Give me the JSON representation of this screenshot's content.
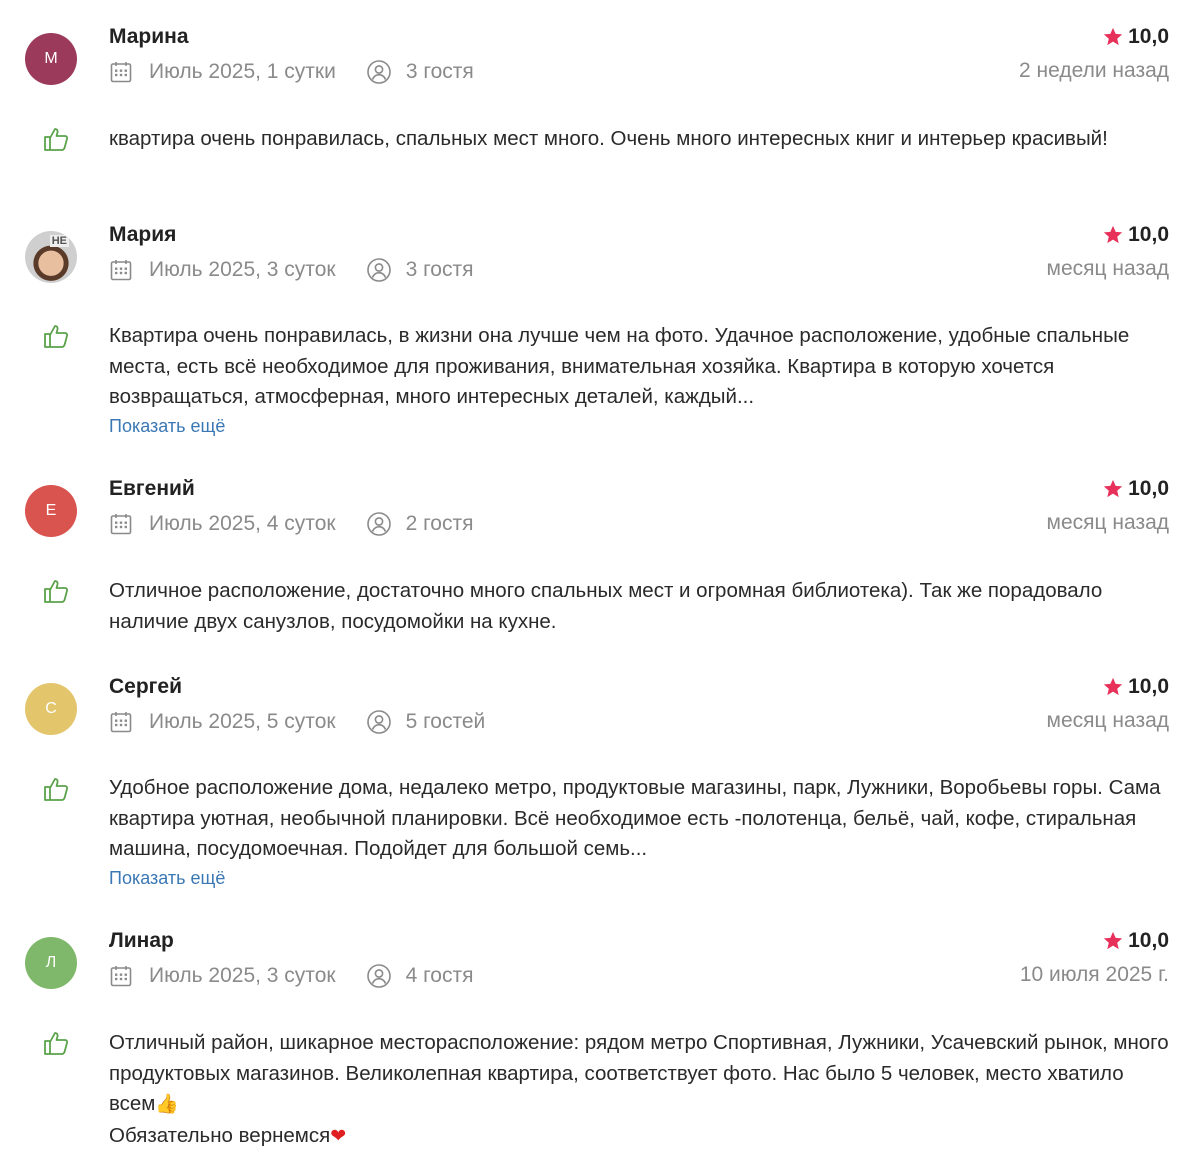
{
  "reviews": [
    {
      "initial": "М",
      "avatar_color": "#9c3a5c",
      "name": "Марина",
      "rating": "10,0",
      "stay": "Июль 2025, 1 сутки",
      "guests": "3 гостя",
      "when": "2 недели назад",
      "text": "квартира очень понравилась, спальных мест много. Очень много интересных книг и интерьер красивый!"
    },
    {
      "initial": "",
      "avatar_sign": "НЕ",
      "name": "Мария",
      "rating": "10,0",
      "stay": "Июль 2025, 3 суток",
      "guests": "3 гостя",
      "when": "месяц назад",
      "text": "Квартира очень понравилась, в жизни она лучше чем на фото. Удачное расположение, удобные спальные места, есть всё необходимое для проживания, внимательная хозяйка. Квартира в которую хочется возвращаться, атмосферная, много интересных деталей, каждый...",
      "more": "Показать ещё"
    },
    {
      "initial": "Е",
      "avatar_color": "#d9534f",
      "name": "Евгений",
      "rating": "10,0",
      "stay": "Июль 2025, 4 суток",
      "guests": "2 гостя",
      "when": "месяц назад",
      "text": "Отличное расположение, достаточно много спальных мест и огромная библиотека). Так же порадовало наличие двух санузлов, посудомойки на кухне."
    },
    {
      "initial": "С",
      "avatar_color": "#e3c56c",
      "name": "Сергей",
      "rating": "10,0",
      "stay": "Июль 2025, 5 суток",
      "guests": "5 гостей",
      "when": "месяц назад",
      "text": "Удобное расположение дома, недалеко метро, продуктовые магазины, парк, Лужники, Воробьевы горы. Сама квартира уютная, необычной планировки. Всё необходимое есть -полотенца, бельё, чай, кофе, стиральная машина, посудомоечная. Подойдет для большой семь...",
      "more": "Показать ещё"
    },
    {
      "initial": "Л",
      "avatar_color": "#7fb86a",
      "name": "Линар",
      "rating": "10,0",
      "stay": "Июль 2025, 3 суток",
      "guests": "4 гостя",
      "when": "10 июля 2025 г.",
      "text": "Отличный район, шикарное месторасположение: рядом метро Спортивная, Лужники, Усачевский рынок, много продуктовых магазинов. Великолепная квартира, соответствует фото. Нас было 5 человек, место хватило всем",
      "text_emoji": "👍",
      "text2": "Обязательно вернемся",
      "text2_emoji": "❤"
    }
  ]
}
